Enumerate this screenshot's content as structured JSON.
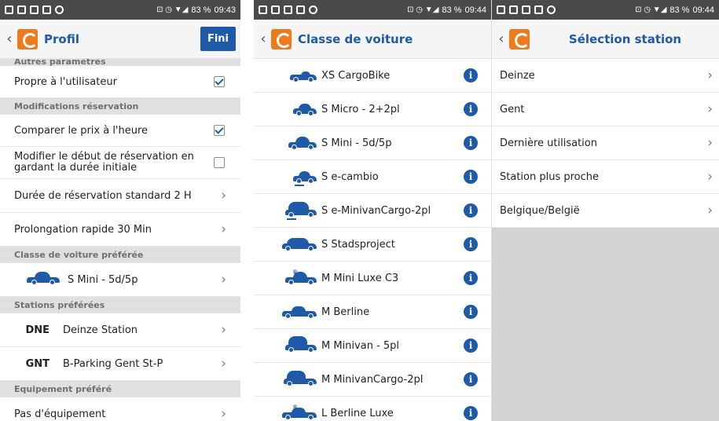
{
  "status": {
    "left_icons": [
      "image-icon",
      "image-icon",
      "image-icon",
      "image-icon",
      "messenger-icon"
    ],
    "indicators": "⊡ ◷ ▼◢",
    "p1": {
      "battery": "83 %",
      "time": "09:43"
    },
    "p2": {
      "battery": "83 %",
      "time": "09:44"
    },
    "p3": {
      "battery": "83 %",
      "time": "09:44"
    }
  },
  "colors": {
    "accent": "#1e5aa8",
    "brand": "#ee7a1e",
    "section": "#e0e0e0"
  },
  "profil": {
    "title": "Profil",
    "done_label": "Fini",
    "sections": {
      "autres": "Autres paramètres",
      "modifs": "Modifications réservation",
      "classe": "Classe de voiture préférée",
      "stations": "Stations préférées",
      "equipement": "Equipement préféré"
    },
    "propre": "Propre à l'utilisateur",
    "comparer": "Comparer le prix à l'heure",
    "modifier": "Modifier le début de réservation en gardant la durée initiale",
    "duree": "Durée de réservation standard 2 H",
    "prolongation": "Prolongation rapide 30 Min",
    "classe_value": "S Mini - 5d/5p",
    "station1": {
      "code": "DNE",
      "name": "Deinze Station"
    },
    "station2": {
      "code": "GNT",
      "name": "B-Parking Gent St-P"
    },
    "equipement_value": "Pas d'équipement",
    "checked": {
      "propre": true,
      "comparer": true,
      "modifier": false
    }
  },
  "classes": {
    "title": "Classe de voiture",
    "items": [
      "XS CargoBike",
      "S Micro - 2+2pl",
      "S Mini - 5d/5p",
      "S e-cambio",
      "S e-MinivanCargo-2pl",
      "S Stadsproject",
      "M Mini Luxe C3",
      "M Berline",
      "M Minivan - 5pl",
      "M MinivanCargo-2pl",
      "L Berline Luxe"
    ]
  },
  "stations": {
    "title": "Sélection station",
    "items": [
      "Deinze",
      "Gent",
      "Dernière utilisation",
      "Station plus proche",
      "Belgique/België"
    ]
  }
}
